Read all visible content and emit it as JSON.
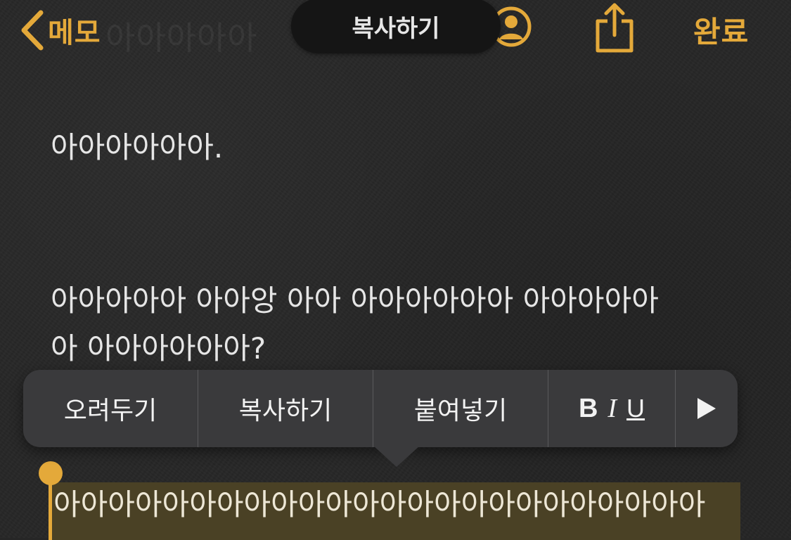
{
  "nav": {
    "back_label": "메모",
    "ghost_title": "아아아아아",
    "copy_label": "복사하기",
    "done_label": "완료"
  },
  "note": {
    "paragraph1": "아아아아아아.",
    "paragraph2_line1": "아아아아아 아아앙 아아 아아아아아아 아아아아아",
    "paragraph2_line2": "아 아아아아아아?",
    "selected_line": "아아아아아아아아아아아아아아아아아아아아아아아아"
  },
  "edit_menu": {
    "cut": "오려두기",
    "copy": "복사하기",
    "paste": "붙여넣기",
    "bold": "B",
    "italic": "I",
    "underline": "U"
  },
  "icons": {
    "back": "chevron-left-icon",
    "people": "person-circle-icon",
    "share": "share-icon",
    "more": "play-arrow-icon"
  },
  "colors": {
    "accent": "#E4A93A",
    "background": "#272727",
    "menu": "#3A3A3C",
    "selection": "#4A4125"
  }
}
